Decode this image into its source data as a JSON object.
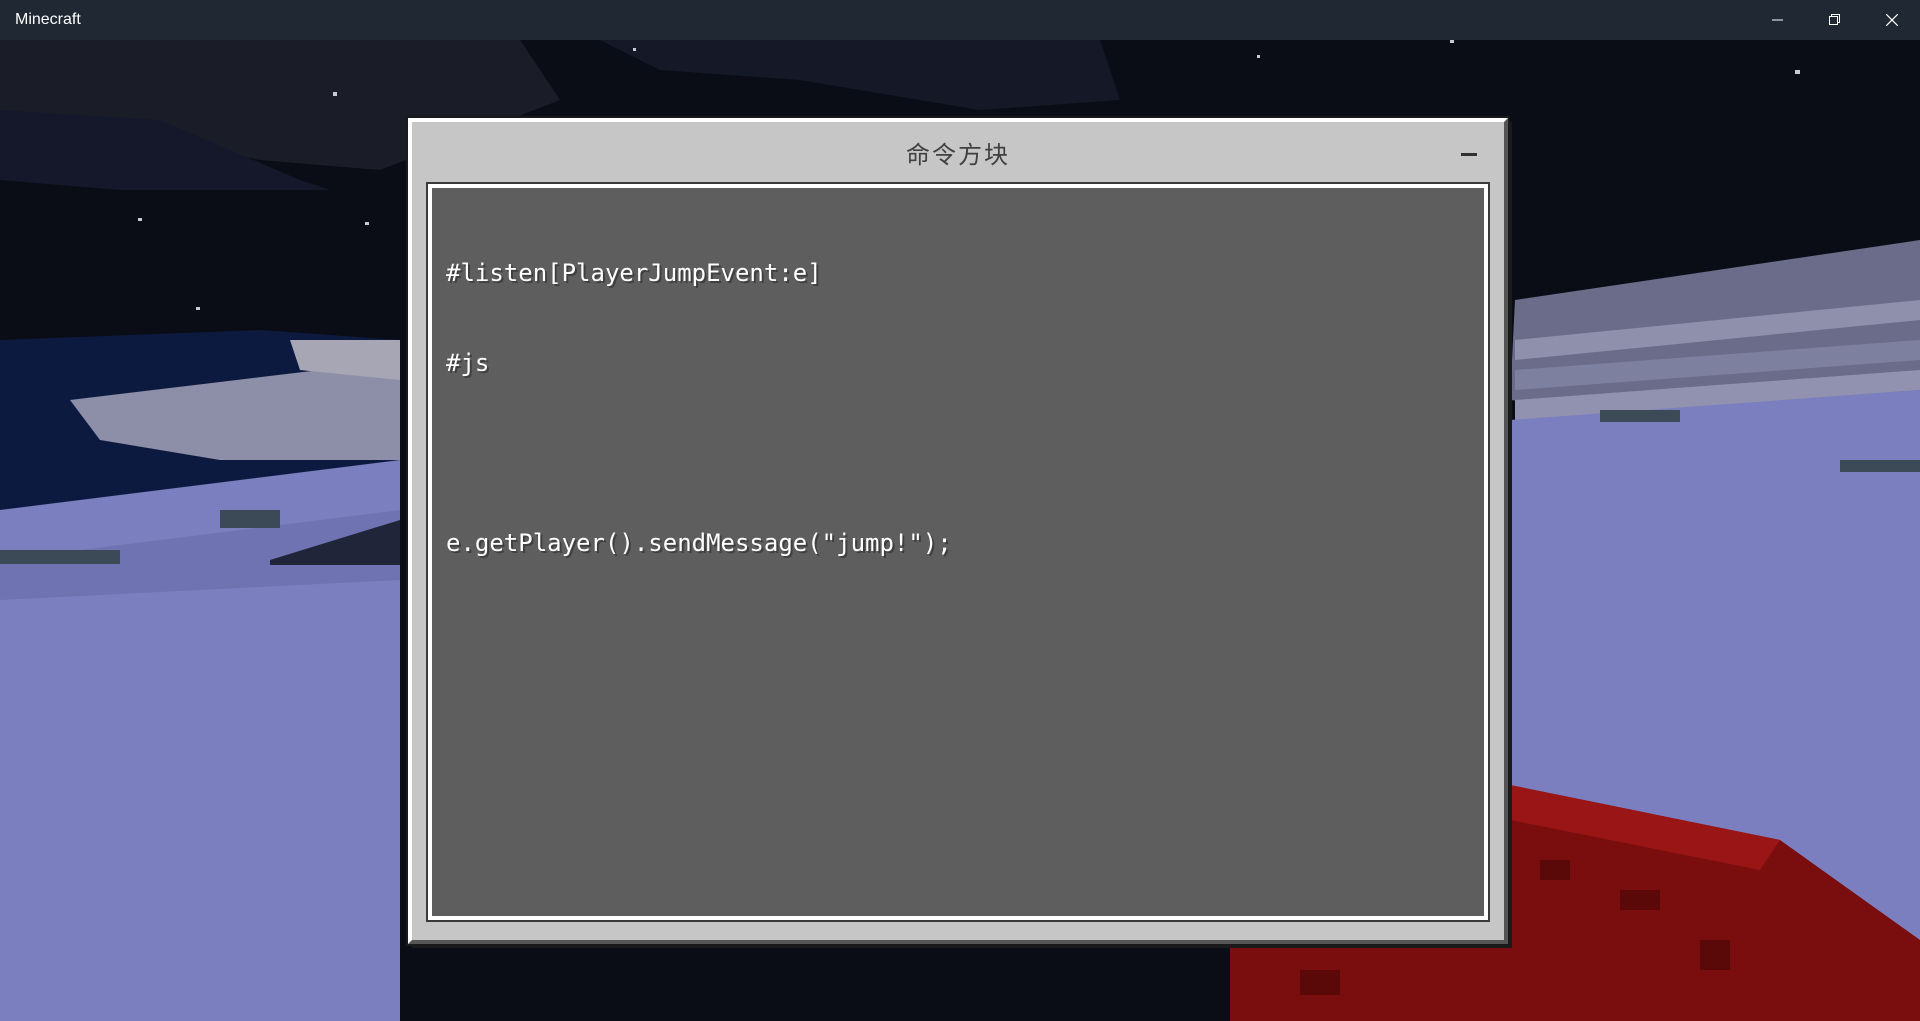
{
  "window": {
    "title": "Minecraft",
    "controls": [
      "minimize",
      "restore",
      "close"
    ]
  },
  "dialog": {
    "title": "命令方块",
    "minimize_label": "−",
    "code_lines": [
      "#listen[PlayerJumpEvent:e]",
      "#js",
      "",
      "e.getPlayer().sendMessage(\"jump!\");"
    ]
  },
  "colors": {
    "titlebar": "#1f2833",
    "dialog_bg": "#c6c6c6",
    "editor_bg": "#5e5e5e",
    "snow": "#7b7fbf",
    "sky": "#0b0d16",
    "redstone": "#8a1010"
  }
}
